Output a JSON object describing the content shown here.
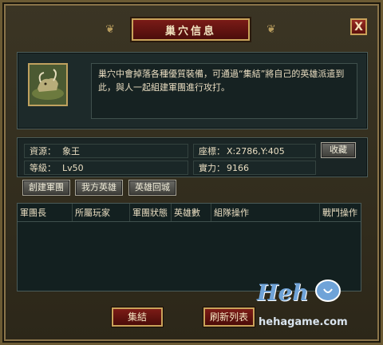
{
  "window": {
    "title": "巢穴信息",
    "close_label": "X"
  },
  "description": "巢穴中會掉落各種優質裝備，可通過“集結”將自己的英雄派遣到此，與人一起組建軍團進行攻打。",
  "info": {
    "resource_label": "資源：",
    "resource_value": "象王",
    "level_label": "等級：",
    "level_value": "Lv50",
    "coord_label": "座標：",
    "coord_value": "X:2786,Y:405",
    "power_label": "實力：",
    "power_value": "9166",
    "favorite_label": "收藏"
  },
  "tabs": [
    "創建軍團",
    "我方英雄",
    "英雄回城"
  ],
  "table": {
    "headers": [
      "軍團長",
      "所屬玩家",
      "軍團狀態",
      "英雄數",
      "組隊操作",
      "戰鬥操作"
    ]
  },
  "footer": {
    "rally_label": "集結",
    "refresh_label": "刷新列表"
  },
  "watermark": {
    "logo": "Heh",
    "url": "hehagame.com"
  },
  "colors": {
    "title_red": "#7a1b17",
    "gold_border": "#c9a35a",
    "panel_teal": "#1d2a2a"
  }
}
